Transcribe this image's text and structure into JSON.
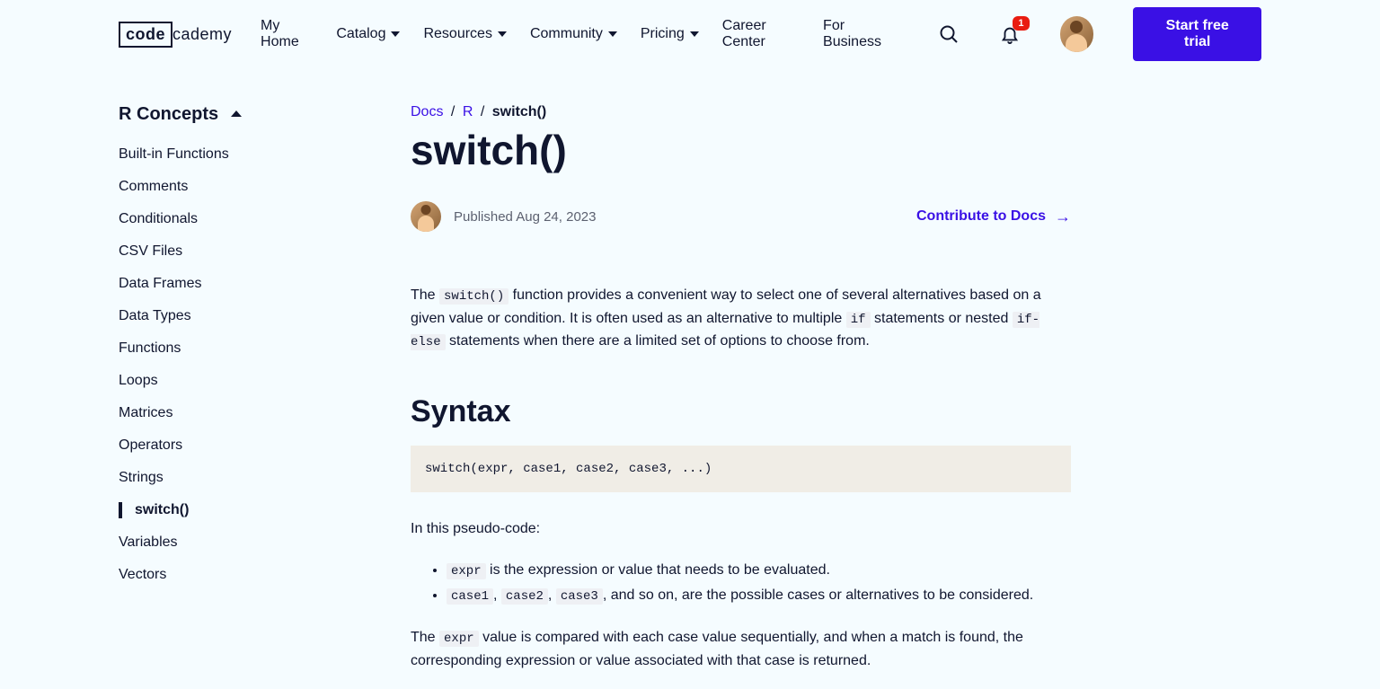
{
  "header": {
    "logo_box": "code",
    "logo_rest": "cademy",
    "nav": {
      "home": "My Home",
      "catalog": "Catalog",
      "resources": "Resources",
      "community": "Community",
      "pricing": "Pricing",
      "career": "Career Center",
      "business": "For Business"
    },
    "badge": "1",
    "cta": "Start free trial"
  },
  "sidebar": {
    "title": "R Concepts",
    "items": [
      "Built-in Functions",
      "Comments",
      "Conditionals",
      "CSV Files",
      "Data Frames",
      "Data Types",
      "Functions",
      "Loops",
      "Matrices",
      "Operators",
      "Strings",
      "switch()",
      "Variables",
      "Vectors"
    ],
    "active": "switch()"
  },
  "breadcrumb": {
    "docs": "Docs",
    "r": "R",
    "current": "switch()"
  },
  "page": {
    "title": "switch()",
    "published": "Published Aug 24, 2023",
    "contribute": "Contribute to Docs",
    "intro_1": "The ",
    "intro_code1": "switch()",
    "intro_2": " function provides a convenient way to select one of several alternatives based on a given value or condition. It is often used as an alternative to multiple ",
    "intro_code2": "if",
    "intro_3": " statements or nested ",
    "intro_code3": "if-else",
    "intro_4": " statements when there are a limited set of options to choose from.",
    "syntax_heading": "Syntax",
    "syntax_code": "switch(expr, case1, case2, case3, ...)",
    "pseudo_intro": "In this pseudo-code:",
    "li1_code": "expr",
    "li1_text": " is the expression or value that needs to be evaluated.",
    "li2_code1": "case1",
    "li2_sep1": ", ",
    "li2_code2": "case2",
    "li2_sep2": ", ",
    "li2_code3": "case3",
    "li2_text": ", and so on, are the possible cases or alternatives to be considered.",
    "outro_1": "The ",
    "outro_code": "expr",
    "outro_2": " value is compared with each case value sequentially, and when a match is found, the corresponding expression or value associated with that case is returned."
  }
}
